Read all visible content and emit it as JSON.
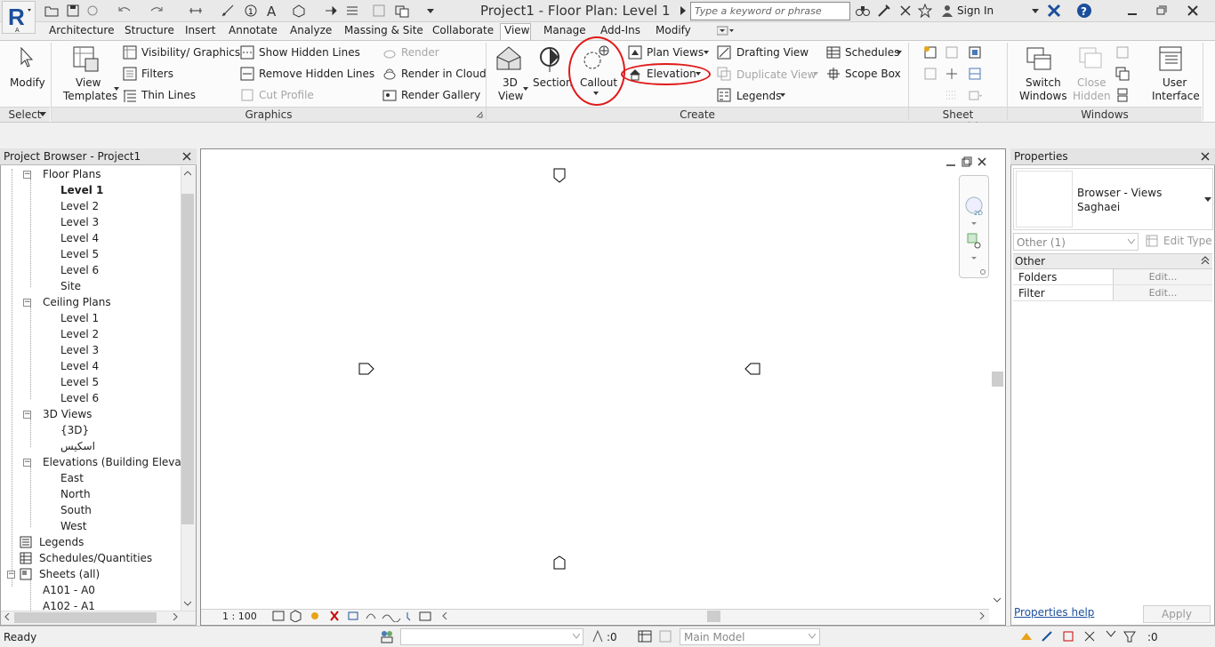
{
  "window": {
    "title": "Project1 - Floor Plan: Level 1"
  },
  "search": {
    "placeholder": "Type a keyword or phrase"
  },
  "account": {
    "sign_in": "Sign In"
  },
  "tabs": [
    "Architecture",
    "Structure",
    "Insert",
    "Annotate",
    "Analyze",
    "Massing & Site",
    "Collaborate",
    "View",
    "Manage",
    "Add-Ins",
    "Modify"
  ],
  "ribbon": {
    "select": {
      "modify": "Modify",
      "panel": "Select"
    },
    "graphics": {
      "view_templates_1": "View",
      "view_templates_2": "Templates",
      "visibility": "Visibility/ Graphics",
      "filters": "Filters",
      "thin_lines": "Thin Lines",
      "show_hidden": "Show  Hidden Lines",
      "remove_hidden": "Remove  Hidden Lines",
      "cut_profile": "Cut  Profile",
      "render": "Render",
      "render_cloud": "Render  in Cloud",
      "render_gallery": "Render  Gallery",
      "panel": "Graphics"
    },
    "create": {
      "view3d_1": "3D",
      "view3d_2": "View",
      "section": "Section",
      "callout": "Callout",
      "plan_views": "Plan  Views",
      "elevation": "Elevation",
      "legends": "Legends",
      "drafting_view": "Drafting  View",
      "duplicate_view": "Duplicate  View",
      "schedules": "Schedules",
      "scope_box": "Scope  Box",
      "panel": "Create"
    },
    "sheet": {
      "panel": "Sheet Composition"
    },
    "windows": {
      "switch_1": "Switch",
      "switch_2": "Windows",
      "close_1": "Close",
      "close_2": "Hidden",
      "ui_1": "User",
      "ui_2": "Interface",
      "panel": "Windows"
    }
  },
  "project_browser": {
    "title": "Project Browser - Project1",
    "floor_plans": "Floor Plans",
    "floor_levels": [
      "Level 1",
      "Level 2",
      "Level 3",
      "Level 4",
      "Level 5",
      "Level 6",
      "Site"
    ],
    "ceiling_plans": "Ceiling Plans",
    "ceiling_levels": [
      "Level 1",
      "Level 2",
      "Level 3",
      "Level 4",
      "Level 5",
      "Level 6"
    ],
    "views_3d": "3D Views",
    "views_3d_items": [
      "{3D}",
      "اسکیس"
    ],
    "elevations": "Elevations (Building Elevation",
    "elevation_items": [
      "East",
      "North",
      "South",
      "West"
    ],
    "legends": "Legends",
    "schedules": "Schedules/Quantities",
    "sheets": "Sheets (all)",
    "sheet_items": [
      "A101 - A0",
      "A102 - A1"
    ]
  },
  "view_bar": {
    "scale": "1 : 100"
  },
  "properties": {
    "title": "Properties",
    "type_line1": "Browser - Views",
    "type_line2": "Saghaei",
    "selector": "Other (1)",
    "edit_type": "Edit Type",
    "group": "Other",
    "rows": [
      {
        "label": "Folders",
        "value": "Edit..."
      },
      {
        "label": "Filter",
        "value": "Edit..."
      }
    ],
    "help": "Properties help",
    "apply": "Apply"
  },
  "status": {
    "ready": "Ready",
    "model": "Main Model",
    "count_a": ":0",
    "count_b": ":0"
  },
  "colors": {
    "highlight": "#e01a1a",
    "revit_blue": "#1b4f9c"
  }
}
